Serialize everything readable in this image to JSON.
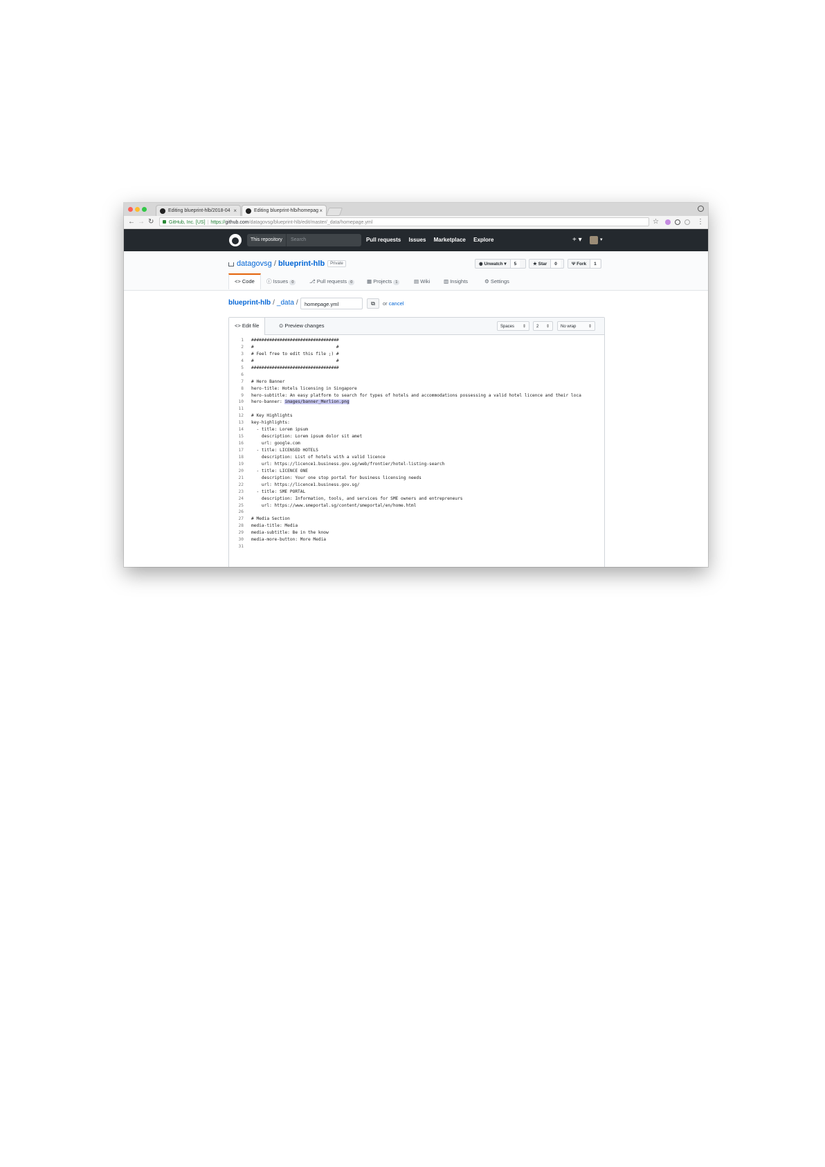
{
  "browser": {
    "tabs": [
      {
        "title": "Editing blueprint-hlb/2018-04"
      },
      {
        "title": "Editing blueprint-hlb/homepag"
      }
    ],
    "close_glyph": "×",
    "address": {
      "secure_label": "GitHub, Inc. [US]",
      "scheme": "https://",
      "host": "github.com",
      "path": "/datagovsg/blueprint-hlb/edit/master/_data/homepage.yml"
    }
  },
  "github_header": {
    "scope_label": "This repository",
    "search_placeholder": "Search",
    "nav": [
      "Pull requests",
      "Issues",
      "Marketplace",
      "Explore"
    ],
    "plus_label": "+ ▾",
    "avatar_caret": "▾"
  },
  "repo": {
    "owner": "datagovsg",
    "separator": "/",
    "name": "blueprint-hlb",
    "visibility": "Private",
    "actions": [
      {
        "label": "Unwatch ▾",
        "count": "5",
        "icon": "eye-icon"
      },
      {
        "label": "Star",
        "count": "0",
        "icon": "star-icon"
      },
      {
        "label": "Fork",
        "count": "1",
        "icon": "fork-icon"
      }
    ],
    "tabs": [
      {
        "label": "Code",
        "prefix": "<>"
      },
      {
        "label": "Issues",
        "count": "0",
        "prefix": "ⓘ"
      },
      {
        "label": "Pull requests",
        "count": "0",
        "prefix": "⎇"
      },
      {
        "label": "Projects",
        "count": "1",
        "prefix": "▦"
      },
      {
        "label": "Wiki",
        "prefix": "▤"
      },
      {
        "label": "Insights",
        "prefix": "▥"
      },
      {
        "label": "Settings",
        "prefix": "⚙"
      }
    ]
  },
  "breadcrumb": {
    "repo": "blueprint-hlb",
    "folder": "_data",
    "separator": "/",
    "filename": "homepage.yml",
    "or_text": "or",
    "cancel": "cancel"
  },
  "editor": {
    "tab_edit": "<> Edit file",
    "tab_preview": "⊙ Preview changes",
    "indent_mode": "Spaces",
    "indent_size": "2",
    "wrap_mode": "No wrap",
    "lines": [
      {
        "n": "1",
        "t": "##################################"
      },
      {
        "n": "2",
        "t": "#                                #"
      },
      {
        "n": "3",
        "t": "# Feel free to edit this file ;) #"
      },
      {
        "n": "4",
        "t": "#                                #"
      },
      {
        "n": "5",
        "t": "##################################"
      },
      {
        "n": "6",
        "t": ""
      },
      {
        "n": "7",
        "t": "# Hero Banner"
      },
      {
        "n": "8",
        "t": "hero-title: Hotels licensing in Singapore"
      },
      {
        "n": "9",
        "t": "hero-subtitle: An easy platform to search for types of hotels and accommodations possessing a valid hotel licence and their loca"
      },
      {
        "n": "10",
        "t": "hero-banner: ",
        "hl": "images/banner_Merlion.png"
      },
      {
        "n": "11",
        "t": ""
      },
      {
        "n": "12",
        "t": "# Key Highlights"
      },
      {
        "n": "13",
        "t": "key-highlights:"
      },
      {
        "n": "14",
        "t": "  - title: Lorem ipsum"
      },
      {
        "n": "15",
        "t": "    description: Lorem ipsum dolor sit amet"
      },
      {
        "n": "16",
        "t": "    url: google.com"
      },
      {
        "n": "17",
        "t": "  - title: LICENSED HOTELS"
      },
      {
        "n": "18",
        "t": "    description: List of hotels with a valid licence"
      },
      {
        "n": "19",
        "t": "    url: https://licence1.business.gov.sg/web/frontier/hotel-listing-search"
      },
      {
        "n": "20",
        "t": "  - title: LICENCE ONE"
      },
      {
        "n": "21",
        "t": "    description: Your one stop portal for business licensing needs"
      },
      {
        "n": "22",
        "t": "    url: https://licence1.business.gov.sg/"
      },
      {
        "n": "23",
        "t": "  - title: SME PORTAL"
      },
      {
        "n": "24",
        "t": "    description: Information, tools, and services for SME owners and entrepreneurs"
      },
      {
        "n": "25",
        "t": "    url: https://www.smeportal.sg/content/smeportal/en/home.html"
      },
      {
        "n": "26",
        "t": ""
      },
      {
        "n": "27",
        "t": "# Media Section"
      },
      {
        "n": "28",
        "t": "media-title: Media"
      },
      {
        "n": "29",
        "t": "media-subtitle: Be in the know"
      },
      {
        "n": "30",
        "t": "media-more-button: More Media"
      },
      {
        "n": "31",
        "t": ""
      }
    ]
  },
  "colors": {
    "header_bg": "#24292e",
    "link": "#0366d6",
    "selected_tab_accent": "#e36209",
    "highlight": "#c8c8f2"
  }
}
